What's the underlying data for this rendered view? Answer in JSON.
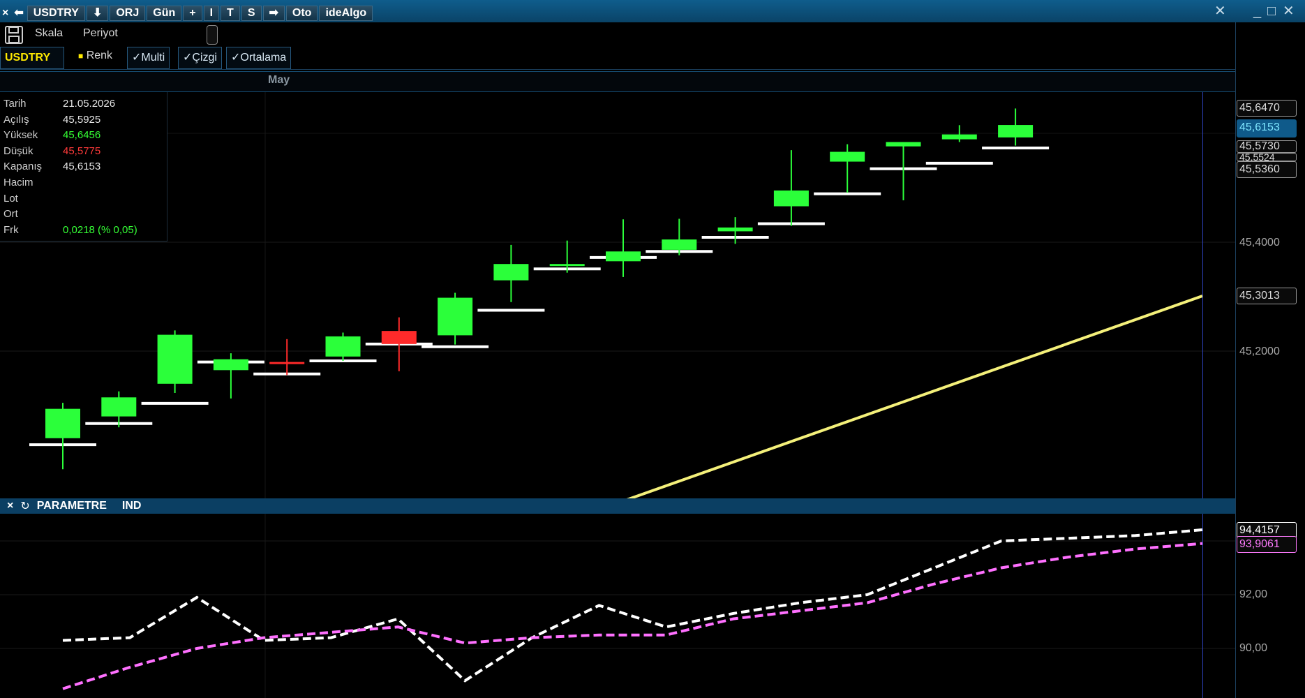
{
  "titlebar": {
    "buttons": [
      {
        "id": "close",
        "label": "×"
      },
      {
        "id": "back",
        "label": "⬅"
      },
      {
        "id": "symbol",
        "label": "USDTRY"
      },
      {
        "id": "download",
        "label": "⬇"
      },
      {
        "id": "orj",
        "label": "ORJ"
      },
      {
        "id": "period",
        "label": "Gün"
      },
      {
        "id": "plus",
        "label": "+"
      },
      {
        "id": "i",
        "label": "I"
      },
      {
        "id": "t",
        "label": "T"
      },
      {
        "id": "s",
        "label": "S"
      },
      {
        "id": "arrow",
        "label": "➡"
      },
      {
        "id": "oto",
        "label": "Oto"
      },
      {
        "id": "idealgo",
        "label": "ideAlgo"
      }
    ],
    "window_close": "✕",
    "window_min": "_",
    "window_max": "□",
    "window_x": "✕"
  },
  "toolbar": {
    "skala": "Skala",
    "periyot": "Periyot"
  },
  "chips": {
    "symbol": "USDTRY",
    "renk": "■ Renk",
    "multi": "✓Multi",
    "cizgi": "✓Çizgi",
    "ortalama": "✓Ortalama"
  },
  "month": "May",
  "info": {
    "rows": [
      {
        "k": "Tarih",
        "v": "21.05.2026",
        "color": "#e6e6e6"
      },
      {
        "k": "Açılış",
        "v": "45,5925",
        "color": "#e6e6e6"
      },
      {
        "k": "Yüksek",
        "v": "45,6456",
        "color": "#35ff35"
      },
      {
        "k": "Düşük",
        "v": "45,5775",
        "color": "#ff3a3a"
      },
      {
        "k": "Kapanış",
        "v": "45,6153",
        "color": "#e6e6e6"
      },
      {
        "k": "Hacim",
        "v": "",
        "color": "#e6e6e6"
      },
      {
        "k": "Lot",
        "v": "",
        "color": "#e6e6e6"
      },
      {
        "k": "Ort",
        "v": "",
        "color": "#e6e6e6"
      },
      {
        "k": "Frk",
        "v": "0,0218 (% 0,05)",
        "color": "#35ff35"
      }
    ]
  },
  "price_axis": {
    "ticks": [
      "45,4000",
      "45,2000"
    ],
    "tags": [
      {
        "value": "45,6470",
        "color": "#9a9a9a",
        "border": "#9a9a9a"
      },
      {
        "value": "45,6153",
        "color": "#7fe6ff",
        "border": "#0f5a8a",
        "bg": "#0f5a8a"
      },
      {
        "value": "45,5730",
        "color": "#ffe000",
        "border": "#ffe000"
      },
      {
        "value": "45,5524",
        "color": "#1ee0a0",
        "border": "#1ee0a0"
      },
      {
        "value": "45,5360",
        "color": "#d0d0d0",
        "border": "#d0d0d0"
      },
      {
        "value": "45,3013",
        "color": "#ffe86a",
        "border": "#ffe86a"
      }
    ]
  },
  "subpanel": {
    "close": "×",
    "refresh": "↻",
    "parametre": "PARAMETRE",
    "ind": "IND",
    "ticks": [
      "92,00",
      "90,00"
    ],
    "tags": [
      {
        "value": "94,4157",
        "color": "#ffffff",
        "border": "#ffffff"
      },
      {
        "value": "93,9061",
        "color": "#ff7bff",
        "border": "#ff7bff"
      }
    ]
  },
  "chart_data": {
    "type": "candlestick",
    "y_axis_ticks": [
      45.4,
      45.2
    ],
    "candles": [
      {
        "open": 45.094,
        "high": 45.105,
        "low": 44.983,
        "close": 45.04,
        "dir": "up"
      },
      {
        "open": 45.08,
        "high": 45.126,
        "low": 45.06,
        "close": 45.115,
        "dir": "up"
      },
      {
        "open": 45.14,
        "high": 45.238,
        "low": 45.123,
        "close": 45.23,
        "dir": "up"
      },
      {
        "open": 45.165,
        "high": 45.196,
        "low": 45.113,
        "close": 45.185,
        "dir": "up"
      },
      {
        "open": 45.18,
        "high": 45.222,
        "low": 45.156,
        "close": 45.18,
        "dir": "down"
      },
      {
        "open": 45.19,
        "high": 45.234,
        "low": 45.182,
        "close": 45.227,
        "dir": "up"
      },
      {
        "open": 45.237,
        "high": 45.262,
        "low": 45.163,
        "close": 45.213,
        "dir": "down"
      },
      {
        "open": 45.229,
        "high": 45.307,
        "low": 45.212,
        "close": 45.298,
        "dir": "up"
      },
      {
        "open": 45.33,
        "high": 45.395,
        "low": 45.29,
        "close": 45.36,
        "dir": "up"
      },
      {
        "open": 45.357,
        "high": 45.403,
        "low": 45.344,
        "close": 45.36,
        "dir": "up"
      },
      {
        "open": 45.365,
        "high": 45.442,
        "low": 45.336,
        "close": 45.383,
        "dir": "up"
      },
      {
        "open": 45.386,
        "high": 45.443,
        "low": 45.376,
        "close": 45.405,
        "dir": "up"
      },
      {
        "open": 45.42,
        "high": 45.446,
        "low": 45.397,
        "close": 45.427,
        "dir": "up"
      },
      {
        "open": 45.466,
        "high": 45.569,
        "low": 45.43,
        "close": 45.495,
        "dir": "up"
      },
      {
        "open": 45.548,
        "high": 45.58,
        "low": 45.491,
        "close": 45.566,
        "dir": "up"
      },
      {
        "open": 45.576,
        "high": 45.584,
        "low": 45.477,
        "close": 45.584,
        "dir": "up"
      },
      {
        "open": 45.589,
        "high": 45.615,
        "low": 45.584,
        "close": 45.598,
        "dir": "up"
      },
      {
        "open": 45.5925,
        "high": 45.6456,
        "low": 45.5775,
        "close": 45.6153,
        "dir": "up"
      }
    ],
    "white_line_values": [
      45.028,
      45.067,
      45.104,
      45.18,
      45.158,
      45.182,
      45.213,
      45.208,
      45.275,
      45.351,
      45.372,
      45.383,
      45.409,
      45.434,
      45.489,
      45.535,
      45.545,
      45.573
    ],
    "yellow_line": {
      "start": 44.828,
      "end": 45.3013
    },
    "sub_series": [
      {
        "color": "#ffffff",
        "values": [
          90.3,
          90.4,
          91.9,
          90.3,
          90.4,
          91.1,
          88.8,
          90.4,
          91.6,
          90.8,
          91.3,
          91.7,
          92.0,
          93.0,
          94.0,
          94.1,
          94.2,
          94.4157
        ]
      },
      {
        "color": "#ff70ff",
        "values": [
          88.5,
          89.3,
          90.0,
          90.4,
          90.6,
          90.8,
          90.2,
          90.4,
          90.5,
          90.5,
          91.1,
          91.4,
          91.7,
          92.4,
          93.0,
          93.4,
          93.7,
          93.9061
        ]
      }
    ]
  }
}
